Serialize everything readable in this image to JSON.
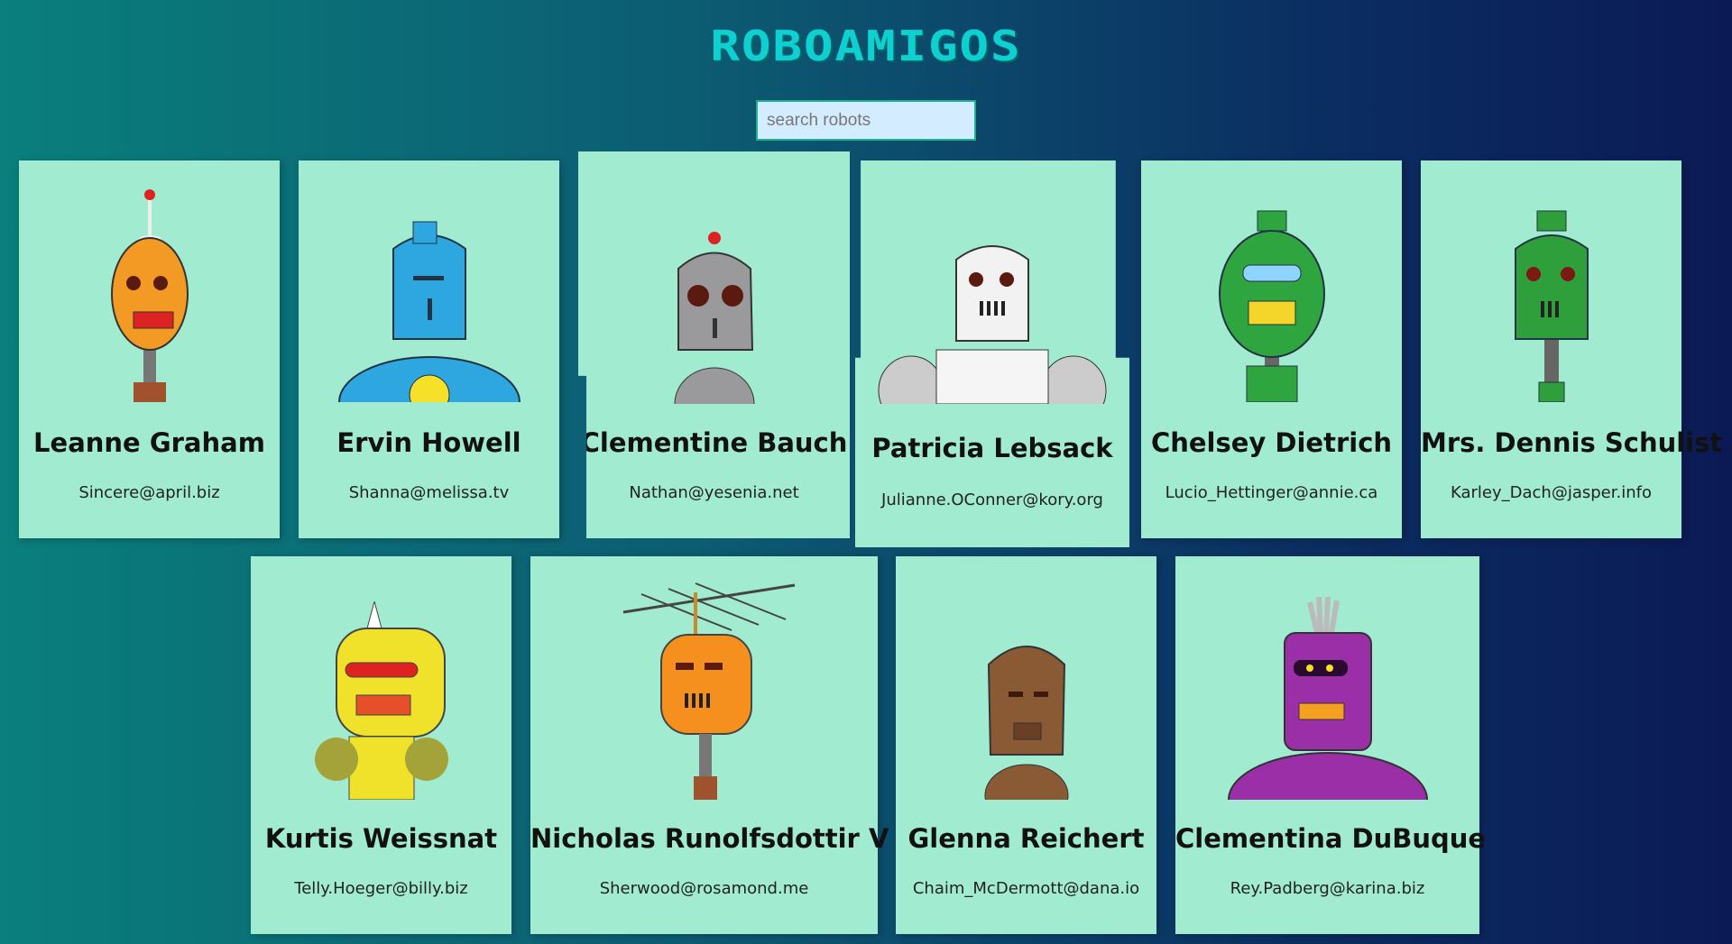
{
  "app": {
    "title": "ROBOAMIGOS",
    "search_placeholder": "search robots"
  },
  "robots": [
    {
      "name": "Leanne Graham",
      "email": "Sincere@april.biz",
      "color": "#f39a25"
    },
    {
      "name": "Ervin Howell",
      "email": "Shanna@melissa.tv",
      "color": "#2ea7e0"
    },
    {
      "name": "Clementine Bauch",
      "email": "Nathan@yesenia.net",
      "color": "#9a9a9c"
    },
    {
      "name": "Patricia Lebsack",
      "email": "Julianne.OConner@kory.org",
      "color": "#f2f2f2"
    },
    {
      "name": "Chelsey Dietrich",
      "email": "Lucio_Hettinger@annie.ca",
      "color": "#2fa53f"
    },
    {
      "name": "Mrs. Dennis Schulist",
      "email": "Karley_Dach@jasper.info",
      "color": "#2f9f3c"
    },
    {
      "name": "Kurtis Weissnat",
      "email": "Telly.Hoeger@billy.biz",
      "color": "#f0e12a"
    },
    {
      "name": "Nicholas Runolfsdottir V",
      "email": "Sherwood@rosamond.me",
      "color": "#f5901e"
    },
    {
      "name": "Glenna Reichert",
      "email": "Chaim_McDermott@dana.io",
      "color": "#8a5a35"
    },
    {
      "name": "Clementina DuBuque",
      "email": "Rey.Padberg@karina.biz",
      "color": "#9b2fa8"
    }
  ]
}
